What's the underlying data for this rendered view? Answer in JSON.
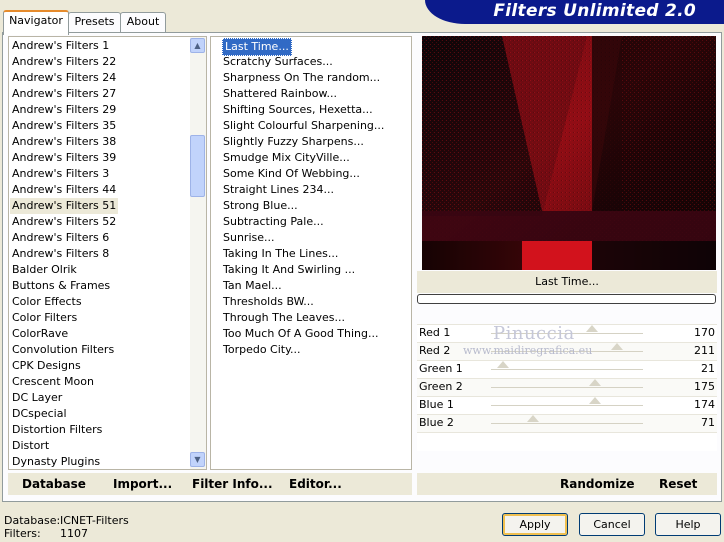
{
  "banner": {
    "title": "Filters Unlimited 2.0"
  },
  "tabs": [
    {
      "label": "Navigator",
      "active": true
    },
    {
      "label": "Presets",
      "active": false
    },
    {
      "label": "About",
      "active": false
    }
  ],
  "categories": [
    "Andrew's Filters 1",
    "Andrew's Filters 22",
    "Andrew's Filters 24",
    "Andrew's Filters 27",
    "Andrew's Filters 29",
    "Andrew's Filters 35",
    "Andrew's Filters 38",
    "Andrew's Filters 39",
    "Andrew's Filters 3",
    "Andrew's Filters 44",
    "Andrew's Filters 51",
    "Andrew's Filters 52",
    "Andrew's Filters 6",
    "Andrew's Filters 8",
    "Balder Olrik",
    "Buttons & Frames",
    "Color Effects",
    "Color Filters",
    "ColorRave",
    "Convolution Filters",
    "CPK Designs",
    "Crescent Moon",
    "DC Layer",
    "DCspecial",
    "Distortion Filters",
    "Distort",
    "Dynasty Plugins"
  ],
  "selected_category_index": 10,
  "filters": [
    "Last Time...",
    "Scratchy Surfaces...",
    "Sharpness On The random...",
    "Shattered Rainbow...",
    "Shifting Sources, Hexetta...",
    "Slight Colourful Sharpening...",
    "Slightly Fuzzy Sharpens...",
    "Smudge Mix CityVille...",
    "Some Kind Of Webbing...",
    "Straight Lines 234...",
    "Strong Blue...",
    "Subtracting Pale...",
    "Sunrise...",
    "Taking In The Lines...",
    "Taking It And Swirling ...",
    "Tan Mael...",
    "Thresholds BW...",
    "Through The Leaves...",
    "Too Much Of A Good Thing...",
    "Torpedo City..."
  ],
  "selected_filter_index": 0,
  "panel_buttons": {
    "database": "Database",
    "import": "Import...",
    "filter_info": "Filter Info...",
    "editor": "Editor...",
    "randomize": "Randomize",
    "reset": "Reset"
  },
  "preview": {
    "filter_name": "Last Time..."
  },
  "watermark": {
    "line1": "Pinuccia",
    "line2": "www.maidiregrafica.eu"
  },
  "sliders": [
    {
      "label": "Red 1",
      "value": 170,
      "max": 255
    },
    {
      "label": "Red 2",
      "value": 211,
      "max": 255
    },
    {
      "label": "Green 1",
      "value": 21,
      "max": 255
    },
    {
      "label": "Green 2",
      "value": 175,
      "max": 255
    },
    {
      "label": "Blue 1",
      "value": 174,
      "max": 255
    },
    {
      "label": "Blue 2",
      "value": 71,
      "max": 255
    }
  ],
  "status": {
    "database_label": "Database:",
    "database_value": "ICNET-Filters",
    "filters_label": "Filters:",
    "filters_value": "1107"
  },
  "dialog_buttons": {
    "apply": "Apply",
    "cancel": "Cancel",
    "help": "Help"
  },
  "colors": {
    "banner": "#0b1a8c",
    "selection": "#316ac5",
    "preview_red": "#c8101a"
  }
}
